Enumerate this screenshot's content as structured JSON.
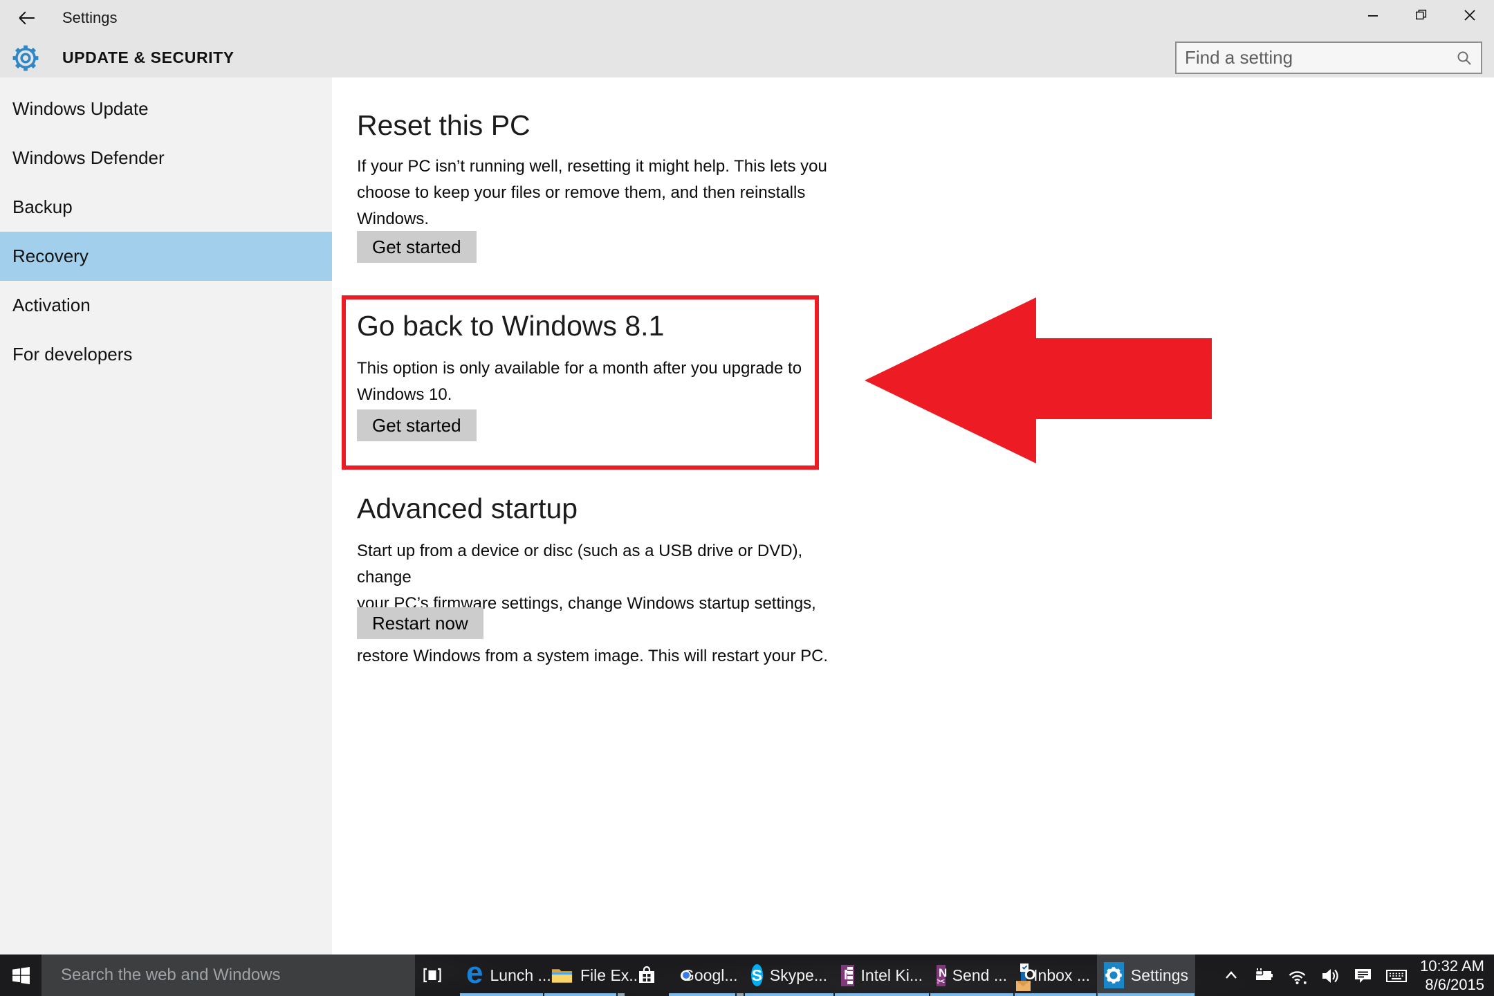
{
  "window": {
    "title": "Settings"
  },
  "header": {
    "title": "UPDATE & SECURITY",
    "search_placeholder": "Find a setting"
  },
  "sidebar": {
    "items": [
      {
        "label": "Windows Update",
        "selected": false
      },
      {
        "label": "Windows Defender",
        "selected": false
      },
      {
        "label": "Backup",
        "selected": false
      },
      {
        "label": "Recovery",
        "selected": true
      },
      {
        "label": "Activation",
        "selected": false
      },
      {
        "label": "For developers",
        "selected": false
      }
    ]
  },
  "main": {
    "sections": [
      {
        "title": "Reset this PC",
        "body": "If your PC isn’t running well, resetting it might help. This lets you\nchoose to keep your files or remove them, and then reinstalls\nWindows.",
        "button": "Get started"
      },
      {
        "title": "Go back to Windows 8.1",
        "body": "This option is only available for a month after you upgrade to\nWindows 10.",
        "button": "Get started",
        "highlighted": true
      },
      {
        "title": "Advanced startup",
        "body": "Start up from a device or disc (such as a USB drive or DVD), change\nyour PC’s firmware settings, change Windows startup settings, or\nrestore Windows from a system image. This will restart your PC.",
        "button": "Restart now"
      }
    ]
  },
  "taskbar": {
    "search_placeholder": "Search the web and Windows",
    "apps": [
      {
        "id": "edge",
        "label": "Lunch ...",
        "running": true
      },
      {
        "id": "file-explorer",
        "label": "File Ex...",
        "running": true,
        "multi": true
      },
      {
        "id": "store",
        "label": "",
        "running": false
      },
      {
        "id": "chrome",
        "label": "Googl...",
        "running": true,
        "multi": true
      },
      {
        "id": "skype",
        "label": "Skype...",
        "running": true
      },
      {
        "id": "onenote",
        "label": "Intel Ki...",
        "running": true
      },
      {
        "id": "send-to-onenote",
        "label": "Send ...",
        "running": true
      },
      {
        "id": "outlook",
        "label": "Inbox ...",
        "running": true
      },
      {
        "id": "settings",
        "label": "Settings",
        "running": true,
        "active": true
      }
    ],
    "tray": {
      "time": "10:32 AM",
      "date": "8/6/2015"
    }
  },
  "icon_glyphs": {
    "edge": "e",
    "skype": "S",
    "onenote": "N",
    "send_note": "N",
    "scissors": "✂",
    "outlook": "O"
  },
  "colors": {
    "annotation_red": "#ed1c24",
    "nav_selected": "#a2cfec",
    "taskbar_underline": "#7cb9e8",
    "header_bg": "#e5e5e5",
    "sidebar_bg": "#f2f2f2"
  }
}
